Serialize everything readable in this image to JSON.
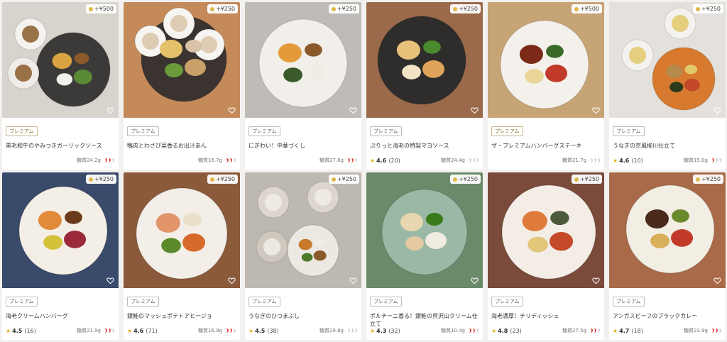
{
  "products": [
    {
      "price": "+¥500",
      "badge": "プレミアム",
      "badge_style": "gold",
      "name": "黒毛和牛のやみつきガーリックソース",
      "rating": "",
      "reviews": "",
      "carb": "糖質24.2g",
      "spice": 2
    },
    {
      "price": "+¥250",
      "badge": "プレミアム",
      "badge_style": "grey",
      "name": "鴨肉とわさび菜香るお出汁あん",
      "rating": "",
      "reviews": "",
      "carb": "糖質16.7g",
      "spice": 2
    },
    {
      "price": "+¥250",
      "badge": "プレミアム",
      "badge_style": "grey",
      "name": "にぎわい！中華づくし",
      "rating": "",
      "reviews": "",
      "carb": "糖質27.8g",
      "spice": 2
    },
    {
      "price": "+¥250",
      "badge": "プレミアム",
      "badge_style": "grey",
      "name": "ぷりっと海老の特製マヨソース",
      "rating": "4.6",
      "reviews": "(20)",
      "carb": "糖質24.4g",
      "spice": 0
    },
    {
      "price": "+¥500",
      "badge": "プレミアム",
      "badge_style": "gold",
      "name": "ザ・プレミアムハンバーグステーキ",
      "rating": "",
      "reviews": "",
      "carb": "糖質21.7g",
      "spice": 0
    },
    {
      "price": "+¥250",
      "badge": "プレミアム",
      "badge_style": "grey",
      "name": "うなぎの京風柳川仕立て",
      "rating": "4.6",
      "reviews": "(10)",
      "carb": "糖質15.0g",
      "spice": 1
    },
    {
      "price": "+¥250",
      "badge": "プレミアム",
      "badge_style": "grey",
      "name": "海老クリームハンバーグ",
      "rating": "4.5",
      "reviews": "(16)",
      "carb": "糖質21.9g",
      "spice": 2
    },
    {
      "price": "+¥250",
      "badge": "プレミアム",
      "badge_style": "grey",
      "name": "銀鮭のマッシュポテトアヒージョ",
      "rating": "4.6",
      "reviews": "(71)",
      "carb": "糖質16.9g",
      "spice": 2
    },
    {
      "price": "+¥250",
      "badge": "プレミアム",
      "badge_style": "grey",
      "name": "うなぎのひつまぶし",
      "rating": "4.5",
      "reviews": "(38)",
      "carb": "糖質29.8g",
      "spice": 0
    },
    {
      "price": "+¥250",
      "badge": "プレミアム",
      "badge_style": "grey",
      "name": "ポルチーニ香る！銀鮭の貝沢山クリーム仕立て",
      "rating": "4.3",
      "reviews": "(32)",
      "carb": "糖質10.4g",
      "spice": 2
    },
    {
      "price": "+¥250",
      "badge": "プレミアム",
      "badge_style": "grey",
      "name": "海老濃厚！チリディッシュ",
      "rating": "4.8",
      "reviews": "(23)",
      "carb": "糖質27.5g",
      "spice": 2
    },
    {
      "price": "+¥250",
      "badge": "プレミアム",
      "badge_style": "grey",
      "name": "アンガスビーフのブラックカレー",
      "rating": "4.7",
      "reviews": "(18)",
      "carb": "糖質23.9g",
      "spice": 2
    }
  ],
  "colors": {
    "star": "#e2b022",
    "chili_active": "#d9322b",
    "chili_inactive": "#c9c9c9",
    "premium_gold": "#8a6b2a",
    "premium_grey": "#666666"
  },
  "icons": {
    "price_prefix": "coin-icon",
    "favorite": "heart-outline-icon",
    "spice": "chili-pepper-icon",
    "rating": "star-icon"
  }
}
